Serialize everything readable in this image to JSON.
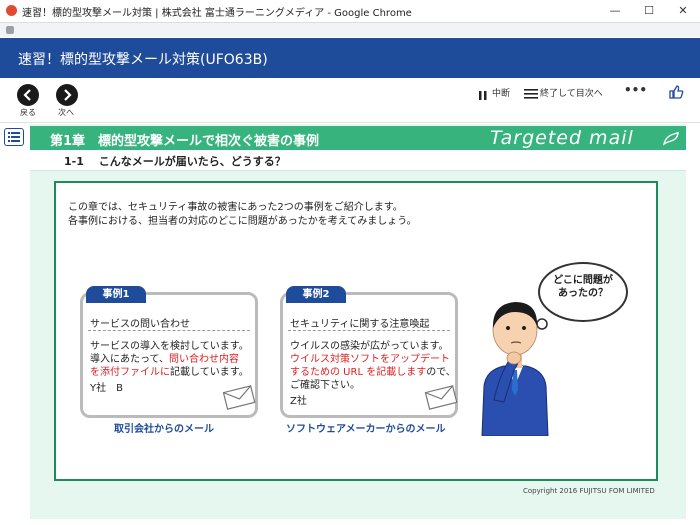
{
  "window": {
    "title": "速習！標的型攻撃メール対策 | 株式会社 富士通ラーニングメディア - Google Chrome",
    "minimize_glyph": "—",
    "maximize_glyph": "☐",
    "close_glyph": "✕"
  },
  "course": {
    "title": "速習！標的型攻撃メール対策(UFO63B)"
  },
  "toolbar": {
    "back_label": "戻る",
    "next_label": "次へ",
    "pause_label": "中断",
    "exit_label": "終了して目次へ",
    "more_glyph": "•••"
  },
  "chapter": {
    "title": "第1章　標的型攻撃メールで相次ぐ被害の事例",
    "brand": "Targeted mail",
    "section": "1-1　 こんなメールが届いたら、どうする？"
  },
  "intro": {
    "line1": "この章では、セキュリティ事故の被害にあった2つの事例をご紹介します。",
    "line2": "各事例における、担当者の対応のどこに問題があったかを考えてみましょう。"
  },
  "cases": [
    {
      "tab": "事例1",
      "subject": "サービスの問い合わせ",
      "line1": "サービスの導入を検討しています。",
      "line2a": "導入にあたって、",
      "line2b": "問い合わせ内容",
      "line3a": "を添付ファイルに",
      "line3b": "記載しています。",
      "sender": "Y社　B",
      "caption": "取引会社からのメール"
    },
    {
      "tab": "事例2",
      "subject": "セキュリティに関する注意喚起",
      "line1": "ウイルスの感染が広がっています。",
      "line2": "ウイルス対策ソフトをアップデート",
      "line3a": "するための URL を記載します",
      "line3b": "ので、",
      "line4": "ご確認下さい。",
      "sender": "Z社",
      "caption": "ソフトウェアメーカーからのメール"
    }
  ],
  "bubble": {
    "line1": "どこに問題が",
    "line2": "あったの？"
  },
  "copyright": "Copyright 2016 FUJITSU FOM LIMITED",
  "colors": {
    "header": "#1e4c9a",
    "chapter": "#37b37e",
    "content_bg": "#e6f7f0",
    "highlight": "#e02020"
  }
}
